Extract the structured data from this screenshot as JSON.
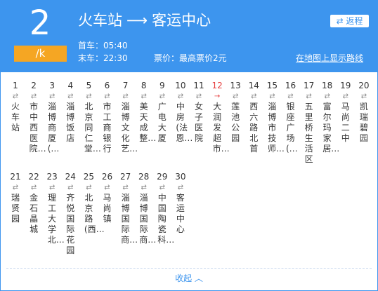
{
  "header": {
    "line_number": "2",
    "line_suffix": "/k",
    "origin": "火车站",
    "arrow": "⟶",
    "destination": "客运中心",
    "first_bus": "首车：05:40",
    "last_bus": "末车：22:30",
    "fare": "票价：最高票价2元",
    "return_label": "⇄ 返程",
    "map_link": "在地图上显示路线"
  },
  "stops_row1": [
    {
      "num": "1",
      "arrows": "⇄",
      "name": "火车站"
    },
    {
      "num": "2",
      "arrows": "⇄",
      "name": "市中西医院…"
    },
    {
      "num": "3",
      "arrows": "⇄",
      "name": "淄博商厦(…"
    },
    {
      "num": "4",
      "arrows": "⇄",
      "name": "淄博饭店"
    },
    {
      "num": "5",
      "arrows": "⇄",
      "name": "北京同仁堂…"
    },
    {
      "num": "6",
      "arrows": "⇄",
      "name": "市工商银行"
    },
    {
      "num": "7",
      "arrows": "⇄",
      "name": "淄博文化艺…"
    },
    {
      "num": "8",
      "arrows": "⇄",
      "name": "美天成整…"
    },
    {
      "num": "9",
      "arrows": "⇄",
      "name": "广电大厦"
    },
    {
      "num": "10",
      "arrows": "⇄",
      "name": "中房(法恩…"
    },
    {
      "num": "11",
      "arrows": "⇄",
      "name": "女子医院"
    },
    {
      "num": "12",
      "arrows": "→",
      "name": "大润发超市…"
    },
    {
      "num": "13",
      "arrows": "⇄",
      "name": "莲池公园"
    },
    {
      "num": "14",
      "arrows": "⇄",
      "name": "西六路北首"
    },
    {
      "num": "15",
      "arrows": "⇄",
      "name": "淄博市技师…"
    },
    {
      "num": "16",
      "arrows": "⇄",
      "name": "银座广场(…"
    },
    {
      "num": "17",
      "arrows": "⇄",
      "name": "五里桥生活区"
    },
    {
      "num": "18",
      "arrows": "⇄",
      "name": "富尔玛家居…"
    },
    {
      "num": "19",
      "arrows": "⇄",
      "name": "马尚二中"
    },
    {
      "num": "20",
      "arrows": "⇄",
      "name": "凯瑞碧园"
    }
  ],
  "stops_row2": [
    {
      "num": "21",
      "arrows": "⇄",
      "name": "瑞贤园"
    },
    {
      "num": "22",
      "arrows": "⇄",
      "name": "金石晶城"
    },
    {
      "num": "23",
      "arrows": "⇄",
      "name": "理工大学北…"
    },
    {
      "num": "24",
      "arrows": "⇄",
      "name": "齐悦国际花园"
    },
    {
      "num": "25",
      "arrows": "⇄",
      "name": "北京路(西…"
    },
    {
      "num": "26",
      "arrows": "⇄",
      "name": "马尚镇"
    },
    {
      "num": "27",
      "arrows": "⇄",
      "name": "淄博国际商…"
    },
    {
      "num": "28",
      "arrows": "⇄",
      "name": "淄博国际商…"
    },
    {
      "num": "29",
      "arrows": "⇄",
      "name": "中国陶瓷科…"
    },
    {
      "num": "30",
      "arrows": "⇄",
      "name": "客运中心"
    }
  ],
  "current_stop": "12",
  "collapse_label": "收起 ︿",
  "colors": {
    "brand": "#3d95ee",
    "accent": "#f5a623",
    "current": "#e63d3d"
  }
}
